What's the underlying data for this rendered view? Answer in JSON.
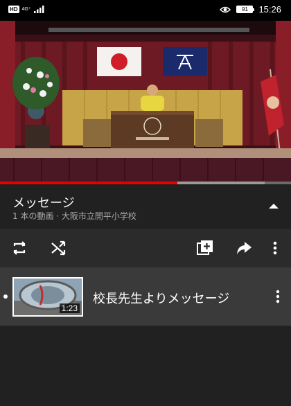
{
  "status_bar": {
    "badge": "HD",
    "network": "4G⁺",
    "battery": "91",
    "time": "15:26",
    "icons": [
      "hd-icon",
      "signal-icon",
      "eye-icon",
      "battery-icon"
    ]
  },
  "player": {
    "progress_played": 0.61,
    "progress_buffered": 0.91
  },
  "playlist": {
    "title": "メッセージ",
    "subtitle": "1 本の動画 · 大阪市立開平小学校",
    "collapse_icon": "chevron-up-icon"
  },
  "actions": {
    "icons": [
      "loop-icon",
      "shuffle-icon",
      "add-to-playlist-icon",
      "share-icon",
      "more-vert-icon"
    ]
  },
  "videos": [
    {
      "title": "校長先生よりメッセージ",
      "duration": "1:23",
      "playing": true
    }
  ],
  "colors": {
    "background": "#212121",
    "actions_bar": "#2b2b2b",
    "selected_row": "#3a3a3a",
    "progress_played": "#e60000",
    "subtitle_text": "#aaaaaa"
  }
}
